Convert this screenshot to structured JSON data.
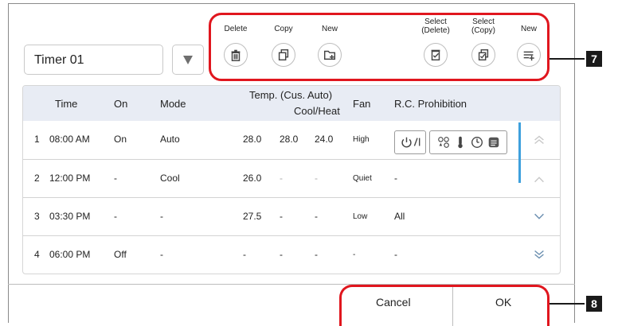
{
  "timer_select": {
    "value": "Timer 01"
  },
  "toolbar": {
    "delete_label": "Delete",
    "copy_label": "Copy",
    "new_label": "New",
    "select_delete_label": "Select\n(Delete)",
    "select_copy_label": "Select\n(Copy)",
    "new_line_label": "New"
  },
  "callouts": {
    "toolbar_tag": "7",
    "dialog_buttons_tag": "8"
  },
  "table": {
    "headers": {
      "time": "Time",
      "on": "On",
      "mode": "Mode",
      "temp_line1": "Temp. (Cus. Auto)",
      "temp_line2": "Cool/Heat",
      "fan": "Fan",
      "prohibition": "R.C. Prohibition"
    },
    "rows": [
      {
        "num": "1",
        "time": "08:00 AM",
        "on": "On",
        "mode": "Auto",
        "t1": "28.0",
        "t2": "28.0",
        "t3": "24.0",
        "fan": "High",
        "prohibition": ""
      },
      {
        "num": "2",
        "time": "12:00 PM",
        "on": "-",
        "mode": "Cool",
        "t1": "26.0",
        "t2": "-",
        "t3": "-",
        "fan": "Quiet",
        "prohibition": "-"
      },
      {
        "num": "3",
        "time": "03:30 PM",
        "on": "-",
        "mode": "-",
        "t1": "27.5",
        "t2": "-",
        "t3": "-",
        "fan": "Low",
        "prohibition": "All"
      },
      {
        "num": "4",
        "time": "06:00 PM",
        "on": "Off",
        "mode": "-",
        "t1": "-",
        "t2": "-",
        "t3": "-",
        "fan": "-",
        "prohibition": "-"
      }
    ],
    "prohibition_icons": [
      "on-off-icon",
      "mode-icons",
      "thermometer-icon",
      "timer-icon",
      "fan-grid-icon"
    ]
  },
  "footer": {
    "cancel_label": "Cancel",
    "ok_label": "OK"
  },
  "colors": {
    "callout_red": "#e0161e",
    "header_bg": "#e8ecf4",
    "scroll_blue": "#3ea0dd"
  }
}
